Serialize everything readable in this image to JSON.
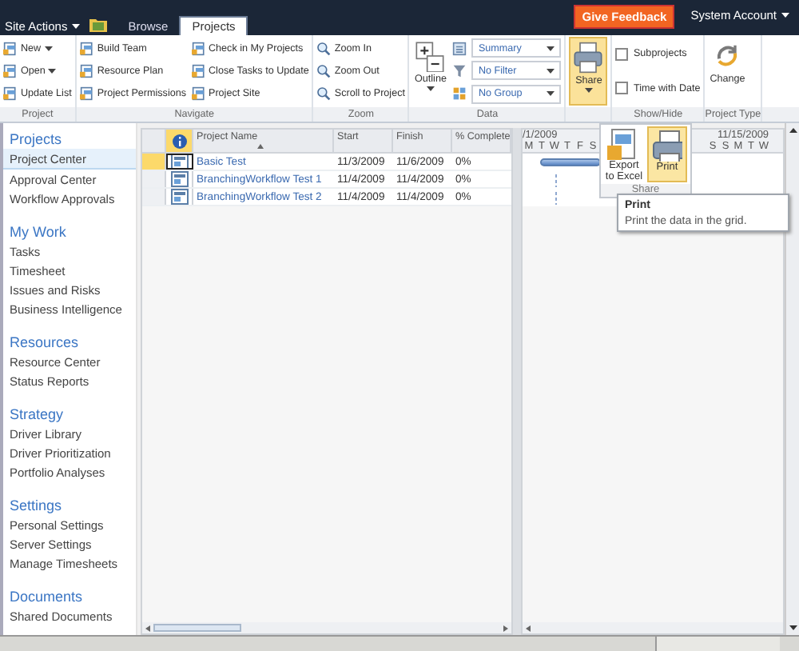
{
  "top_bar": {
    "site_actions": "Site Actions",
    "tabs": [
      {
        "label": "Browse",
        "selected": false
      },
      {
        "label": "Projects",
        "selected": true
      }
    ],
    "feedback": "Give Feedback",
    "account": "System Account"
  },
  "ribbon": {
    "groups": [
      {
        "label": "Project",
        "columns": [
          [
            {
              "kind": "small",
              "label": "New",
              "dropdown": true
            },
            {
              "kind": "small",
              "label": "Open",
              "dropdown": true
            },
            {
              "kind": "small",
              "label": "Update List",
              "dropdown": false
            }
          ]
        ]
      },
      {
        "label": "Navigate",
        "columns": [
          [
            {
              "kind": "small",
              "label": "Build Team",
              "dropdown": false
            },
            {
              "kind": "small",
              "label": "Resource Plan",
              "dropdown": false
            },
            {
              "kind": "small",
              "label": "Project Permissions",
              "dropdown": false
            }
          ],
          [
            {
              "kind": "small",
              "label": "Check in My Projects",
              "dropdown": false
            },
            {
              "kind": "small",
              "label": "Close Tasks to Update",
              "dropdown": false
            },
            {
              "kind": "small",
              "label": "Project Site",
              "dropdown": false
            }
          ]
        ]
      },
      {
        "label": "Zoom",
        "columns": [
          [
            {
              "kind": "small",
              "label": "Zoom In",
              "dropdown": false
            },
            {
              "kind": "small",
              "label": "Zoom Out",
              "dropdown": false
            },
            {
              "kind": "small",
              "label": "Scroll to Project",
              "dropdown": false
            }
          ]
        ]
      },
      {
        "label": "Data",
        "columns": [
          [
            {
              "kind": "large",
              "label": "Outline",
              "dropdown": true,
              "pressed": false
            }
          ],
          [
            {
              "kind": "select",
              "value": "Summary"
            },
            {
              "kind": "select",
              "value": "No Filter"
            },
            {
              "kind": "select",
              "value": "No Group"
            }
          ]
        ]
      },
      {
        "columns": [
          [
            {
              "kind": "large",
              "label": "Share",
              "dropdown": true,
              "pressed": true
            }
          ]
        ]
      },
      {
        "label": "Show/Hide",
        "columns": [
          [
            {
              "kind": "checkbox",
              "label": "Subprojects",
              "checked": false
            },
            {
              "kind": "checkbox",
              "label": "Time with Date",
              "checked": false
            }
          ]
        ]
      },
      {
        "label": "Project Type",
        "columns": [
          [
            {
              "kind": "large",
              "label": "Change",
              "dropdown": false,
              "pressed": false
            }
          ]
        ]
      }
    ]
  },
  "share_menu": {
    "items": [
      {
        "label": "Export to Excel",
        "hovered": false
      },
      {
        "label": "Print",
        "hovered": true
      }
    ],
    "label": "Share"
  },
  "tooltip": {
    "title": "Print",
    "text": "Print the data in the grid."
  },
  "sidebar": {
    "sections": [
      {
        "heading": "Projects",
        "items": [
          {
            "label": "Project Center",
            "selected": true
          },
          {
            "label": "Approval Center",
            "selected": false
          },
          {
            "label": "Workflow Approvals",
            "selected": false
          }
        ]
      },
      {
        "heading": "My Work",
        "items": [
          {
            "label": "Tasks",
            "selected": false
          },
          {
            "label": "Timesheet",
            "selected": false
          },
          {
            "label": "Issues and Risks",
            "selected": false
          },
          {
            "label": "Business Intelligence",
            "selected": false
          }
        ]
      },
      {
        "heading": "Resources",
        "items": [
          {
            "label": "Resource Center",
            "selected": false
          },
          {
            "label": "Status Reports",
            "selected": false
          }
        ]
      },
      {
        "heading": "Strategy",
        "items": [
          {
            "label": "Driver Library",
            "selected": false
          },
          {
            "label": "Driver Prioritization",
            "selected": false
          },
          {
            "label": "Portfolio Analyses",
            "selected": false
          }
        ]
      },
      {
        "heading": "Settings",
        "items": [
          {
            "label": "Personal Settings",
            "selected": false
          },
          {
            "label": "Server Settings",
            "selected": false
          },
          {
            "label": "Manage Timesheets",
            "selected": false
          }
        ]
      },
      {
        "heading": "Documents",
        "items": [
          {
            "label": "Shared Documents",
            "selected": false
          }
        ]
      }
    ]
  },
  "grid": {
    "columns": [
      "Project Name",
      "Start",
      "Finish",
      "% Complete"
    ],
    "rows": [
      {
        "selected": true,
        "cells": [
          "Basic Test",
          "11/3/2009",
          "11/6/2009",
          "0%"
        ]
      },
      {
        "selected": false,
        "cells": [
          "BranchingWorkflow Test 1",
          "11/4/2009",
          "11/4/2009",
          "0%"
        ]
      },
      {
        "selected": false,
        "cells": [
          "BranchingWorkflow Test 2",
          "11/4/2009",
          "11/4/2009",
          "0%"
        ]
      }
    ]
  },
  "gantt": {
    "weeks": [
      {
        "label": "/1/2009",
        "days": [
          "M",
          "T",
          "W",
          "T",
          "F",
          "S"
        ]
      },
      {
        "days": [
          "S"
        ]
      },
      {
        "label": "11/15/2009",
        "days": [
          "S",
          "M",
          "T",
          "W"
        ]
      }
    ],
    "rows": [
      {
        "kind": "bar"
      },
      {
        "kind": "marker"
      },
      {
        "kind": "marker"
      }
    ]
  }
}
